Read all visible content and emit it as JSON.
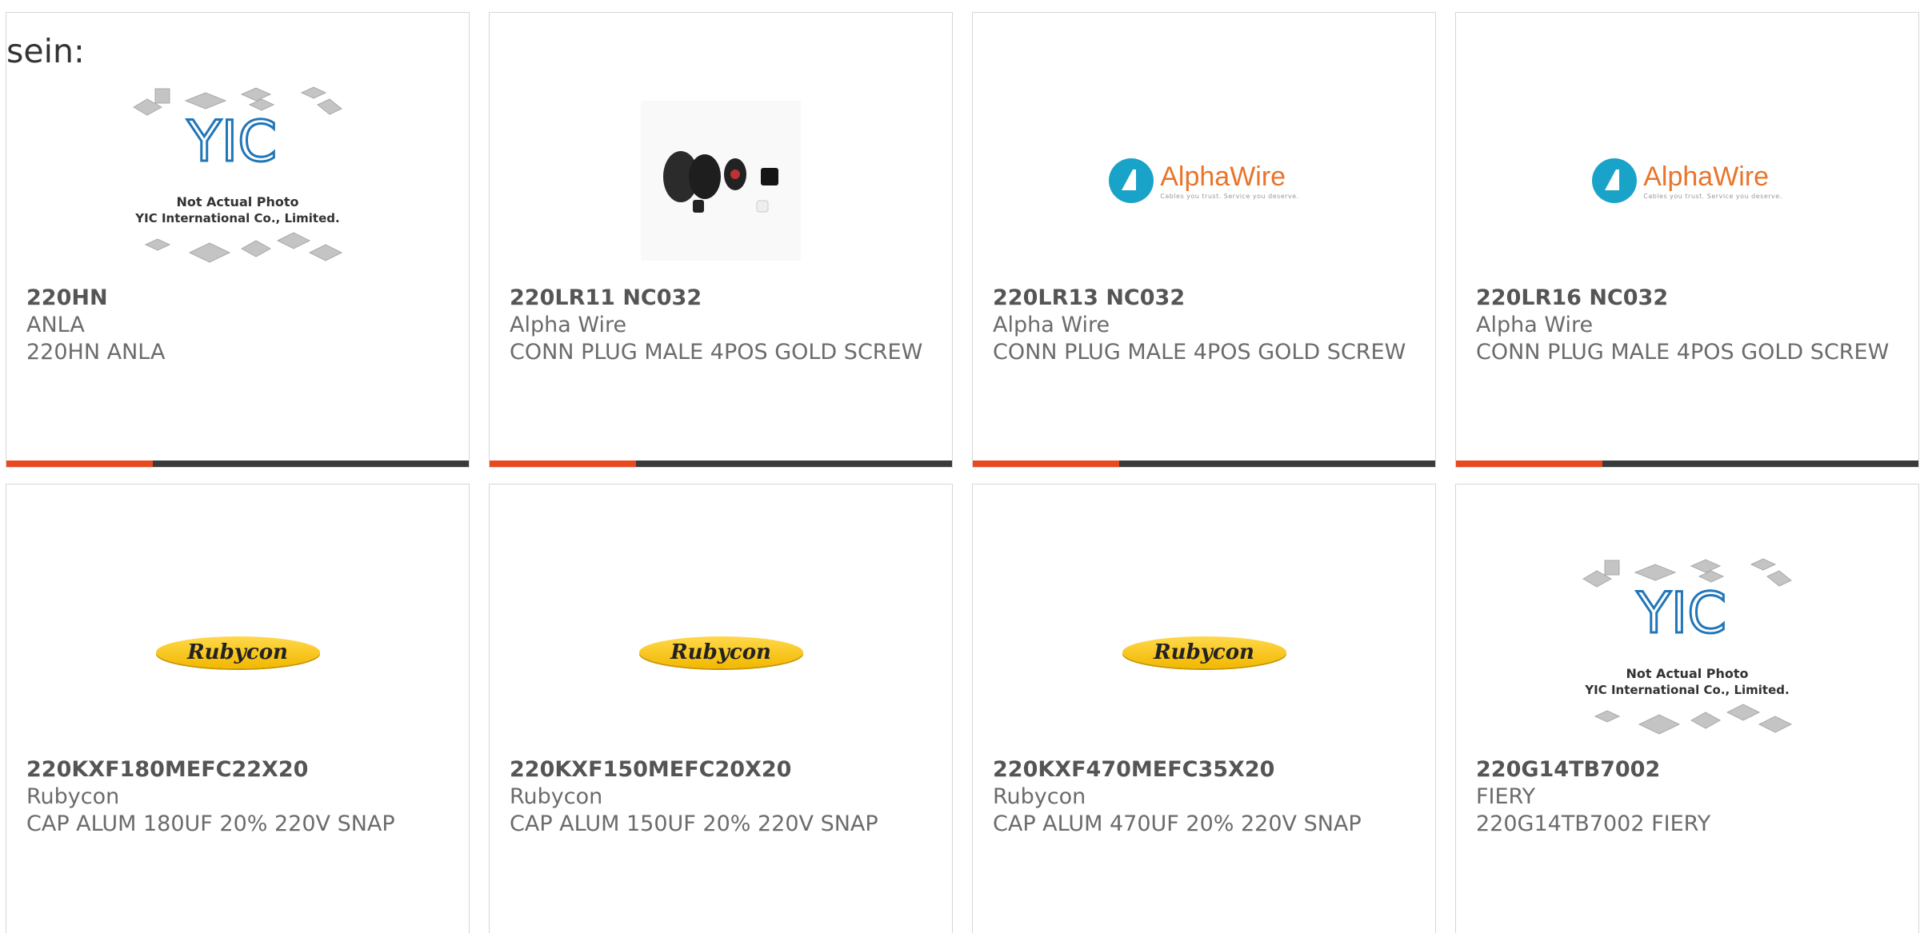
{
  "intro_text": "sein:",
  "colors": {
    "accent": "#e8491e",
    "bar": "#3a3a3a",
    "border": "#d6d6d6",
    "text": "#6b6b6b"
  },
  "products": [
    {
      "part": "220HN",
      "manufacturer": "ANLA",
      "description": "220HN ANLA",
      "image": "yic-placeholder",
      "placeholder_line1": "Not Actual Photo",
      "placeholder_line2": "YIC International Co., Limited.",
      "logo_text": "YIC"
    },
    {
      "part": "220LR11 NC032",
      "manufacturer": "Alpha Wire",
      "description": "CONN PLUG MALE 4POS GOLD SCREW",
      "image": "connector-photo"
    },
    {
      "part": "220LR13 NC032",
      "manufacturer": "Alpha Wire",
      "description": "CONN PLUG MALE 4POS GOLD SCREW",
      "image": "alphawire-logo",
      "logo_text": "AlphaWire",
      "logo_tagline": "Cables you trust. Service you deserve."
    },
    {
      "part": "220LR16 NC032",
      "manufacturer": "Alpha Wire",
      "description": "CONN PLUG MALE 4POS GOLD SCREW",
      "image": "alphawire-logo",
      "logo_text": "AlphaWire",
      "logo_tagline": "Cables you trust. Service you deserve."
    },
    {
      "part": "220KXF180MEFC22X20",
      "manufacturer": "Rubycon",
      "description": "CAP ALUM 180UF 20% 220V SNAP",
      "image": "rubycon-logo",
      "logo_text": "Rubycon"
    },
    {
      "part": "220KXF150MEFC20X20",
      "manufacturer": "Rubycon",
      "description": "CAP ALUM 150UF 20% 220V SNAP",
      "image": "rubycon-logo",
      "logo_text": "Rubycon"
    },
    {
      "part": "220KXF470MEFC35X20",
      "manufacturer": "Rubycon",
      "description": "CAP ALUM 470UF 20% 220V SNAP",
      "image": "rubycon-logo",
      "logo_text": "Rubycon"
    },
    {
      "part": "220G14TB7002",
      "manufacturer": "FIERY",
      "description": "220G14TB7002 FIERY",
      "image": "yic-placeholder",
      "placeholder_line1": "Not Actual Photo",
      "placeholder_line2": "YIC International Co., Limited.",
      "logo_text": "YIC"
    }
  ]
}
